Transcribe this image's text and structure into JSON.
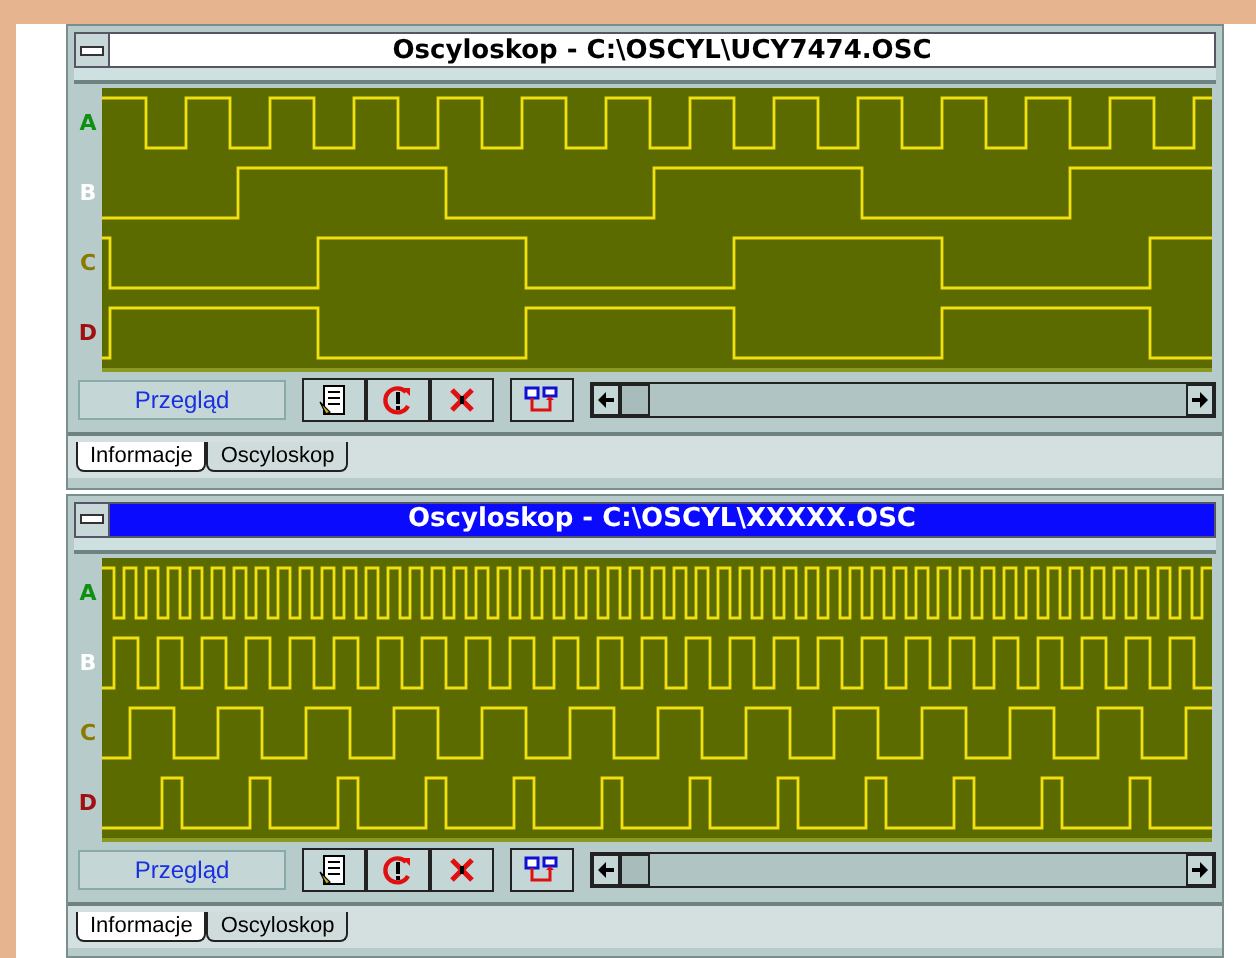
{
  "windows": [
    {
      "title": "Oscyloskop - C:\\OSCYL\\UCY7474.OSC",
      "active": false,
      "channels": [
        {
          "label": "A",
          "color": "#109010"
        },
        {
          "label": "B",
          "color": "#ffffff"
        },
        {
          "label": "C",
          "color": "#8a7a00"
        },
        {
          "label": "D",
          "color": "#a01010"
        }
      ],
      "mode_label": "Przegląd",
      "tabs": [
        {
          "label": "Informacje",
          "selected": true
        },
        {
          "label": "Oscyloskop",
          "selected": false
        }
      ]
    },
    {
      "title": "Oscyloskop - C:\\OSCYL\\XXXXX.OSC",
      "active": true,
      "channels": [
        {
          "label": "A",
          "color": "#109010"
        },
        {
          "label": "B",
          "color": "#ffffff"
        },
        {
          "label": "C",
          "color": "#8a7a00"
        },
        {
          "label": "D",
          "color": "#a01010"
        }
      ],
      "mode_label": "Przegląd",
      "tabs": [
        {
          "label": "Informacje",
          "selected": true
        },
        {
          "label": "Oscyloskop",
          "selected": false
        }
      ]
    }
  ]
}
